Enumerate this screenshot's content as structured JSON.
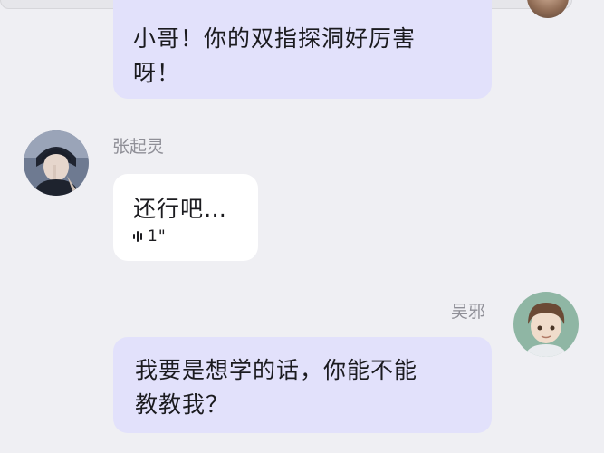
{
  "messages": [
    {
      "sender": "",
      "side": "right",
      "text_lines": [
        "小哥！你的双指探洞好厉害",
        "呀！"
      ]
    },
    {
      "sender": "张起灵",
      "side": "left",
      "text_lines": [
        "还行吧…"
      ],
      "voice_duration": "1\""
    },
    {
      "sender": "吴邪",
      "side": "right",
      "text_lines": [
        "我要是想学的话，你能不能",
        "教教我？"
      ]
    }
  ],
  "colors": {
    "background": "#efeff3",
    "own_bubble": "#e2e1fb",
    "other_bubble": "#ffffff",
    "sender_name": "#8f8f97"
  },
  "icons": [
    "voice-wave-icon"
  ]
}
